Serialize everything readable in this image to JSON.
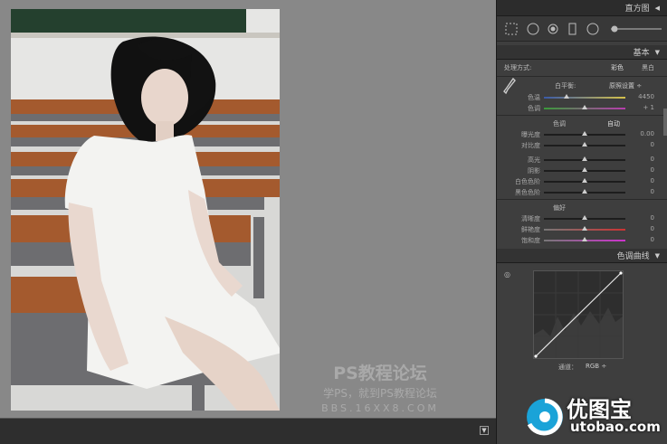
{
  "panel": {
    "histogram_title": "直方图",
    "basic_title": "基本",
    "treatment_label": "处理方式:",
    "treatment_color": "彩色",
    "treatment_bw": "黑白",
    "wb_label": "白平衡:",
    "wb_value": "原照设置 ÷",
    "tone_header": "色调",
    "tone_auto": "自动",
    "presence_header": "偏好",
    "curve_title": "色调曲线",
    "channel_label": "通道：",
    "channel_value": "RGB ÷"
  },
  "sliders": [
    {
      "label": "色温",
      "value": "4450",
      "pos": 0.28,
      "group": "wb",
      "track": "temp"
    },
    {
      "label": "色调",
      "value": "+ 1",
      "pos": 0.5,
      "group": "wb",
      "track": "tint"
    },
    {
      "label": "曝光度",
      "value": "0.00",
      "pos": 0.5,
      "group": "tone",
      "track": "plain"
    },
    {
      "label": "对比度",
      "value": "0",
      "pos": 0.5,
      "group": "tone",
      "track": "plain"
    },
    {
      "label": "高光",
      "value": "0",
      "pos": 0.5,
      "group": "tone2",
      "track": "plain"
    },
    {
      "label": "阴影",
      "value": "0",
      "pos": 0.5,
      "group": "tone2",
      "track": "plain"
    },
    {
      "label": "白色色阶",
      "value": "0",
      "pos": 0.5,
      "group": "tone2",
      "track": "plain"
    },
    {
      "label": "黑色色阶",
      "value": "0",
      "pos": 0.5,
      "group": "tone2",
      "track": "plain"
    },
    {
      "label": "清晰度",
      "value": "0",
      "pos": 0.5,
      "group": "presence",
      "track": "plain"
    },
    {
      "label": "鲜艳度",
      "value": "0",
      "pos": 0.5,
      "group": "presence",
      "track": "vib"
    },
    {
      "label": "饱和度",
      "value": "0",
      "pos": 0.5,
      "group": "presence",
      "track": "sat"
    }
  ],
  "watermark": {
    "line1": "PS教程论坛",
    "line2": "学PS，就到PS教程论坛",
    "line3": "BBS.16XX8.COM"
  },
  "logo": {
    "cn": "优图宝",
    "url": "utobao.com"
  },
  "colors": {
    "accent": "#1aa3d8",
    "panel": "#3e3e3e",
    "canvas": "#888888"
  }
}
